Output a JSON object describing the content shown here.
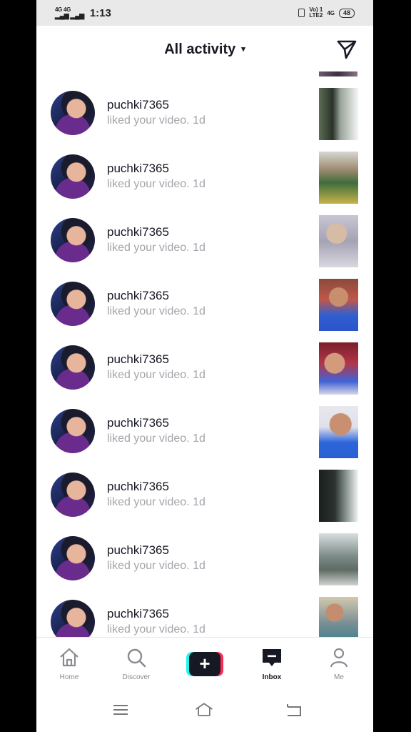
{
  "status_bar": {
    "signal_1": "4G",
    "signal_2": "4G",
    "time": "1:13",
    "volte": "Vo) 1\nLTE2",
    "net": "4G",
    "battery": "48"
  },
  "header": {
    "title": "All activity",
    "caret": "▾"
  },
  "notifications": [
    {
      "username": "puchki7365",
      "action": "liked your video.",
      "age": "1d"
    },
    {
      "username": "puchki7365",
      "action": "liked your video.",
      "age": "1d"
    },
    {
      "username": "puchki7365",
      "action": "liked your video.",
      "age": "1d"
    },
    {
      "username": "puchki7365",
      "action": "liked your video.",
      "age": "1d"
    },
    {
      "username": "puchki7365",
      "action": "liked your video.",
      "age": "1d"
    },
    {
      "username": "puchki7365",
      "action": "liked your video.",
      "age": "1d"
    },
    {
      "username": "puchki7365",
      "action": "liked your video.",
      "age": "1d"
    },
    {
      "username": "puchki7365",
      "action": "liked your video.",
      "age": "1d"
    },
    {
      "username": "puchki7365",
      "action": "liked your video.",
      "age": "1d"
    }
  ],
  "bottom_nav": {
    "home": "Home",
    "discover": "Discover",
    "create": "+",
    "inbox": "Inbox",
    "me": "Me",
    "active": "Inbox"
  },
  "colors": {
    "accent_cyan": "#25f4ee",
    "accent_red": "#fe2c55",
    "text_primary": "#161823",
    "text_secondary": "#a4a5ab"
  },
  "icons": {
    "dm": "paper-plane-icon",
    "home": "house-icon",
    "discover": "magnifier-icon",
    "inbox": "message-icon",
    "me": "person-icon"
  }
}
